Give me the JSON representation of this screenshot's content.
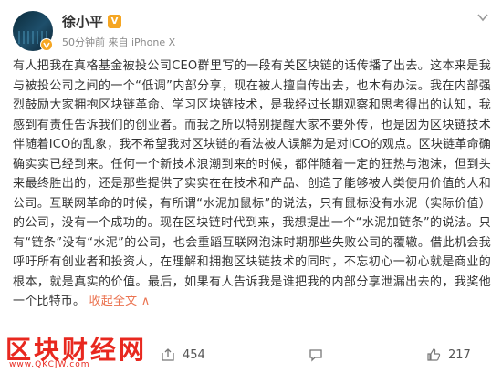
{
  "post": {
    "username": "徐小平",
    "meta": "50分钟前 来自 iPhone X",
    "body_text": "有人把我在真格基金被投公司CEO群里写的一段有关区块链的话传播了出去。这本来是我与被投公司之间的一个“低调”内部分享，现在被人擅自传出去，也木有办法。我在内部强烈鼓励大家拥抱区块链革命、学习区块链技术，是我经过长期观察和思考得出的认知，我感到有责任告诉我们的创业者。而我之所以特别提醒大家不要外传，也是因为区块链技术伴随着ICO的乱象，我不希望我对区块链的看法被人误解为是对ICO的观点。区块链革命确确实实已经到来。任何一个新技术浪潮到来的时候，都伴随着一定的狂热与泡沫，但到头来最终胜出的，还是那些提供了实实在在技术和产品、创造了能够被人类使用价值的人和公司。互联网革命的时候，有所谓“水泥加鼠标”的说法，只有鼠标没有水泥（实际价值）的公司，没有一个成功的。现在区块链时代到来，我想提出一个“水泥加链条”的说法。只有“链条”没有“水泥”的公司，也会重蹈互联网泡沫时期那些失败公司的覆辙。借此机会我呼吁所有创业者和投资人，在理解和拥抱区块链技术的同时，不忘初心一初心就是商业的根本，就是真实的价值。最后，如果有人告诉我是谁把我的内部分享泄漏出去的，我奖他一个比特币。",
    "collapse_label": "收起全文",
    "collapse_arrow": "∧"
  },
  "actions": {
    "share_count": "454",
    "comment_count": "",
    "like_count": "217"
  },
  "watermark": {
    "main": "区块财经网",
    "sub": "www.QKCJW.com"
  },
  "colors": {
    "link": "#eb7350",
    "watermark": "#e8281f",
    "verified": "#f5a623"
  },
  "icons": [
    "verified-badge-icon",
    "vip-icon",
    "chevron-down-icon",
    "share-icon",
    "comment-icon",
    "like-icon"
  ]
}
